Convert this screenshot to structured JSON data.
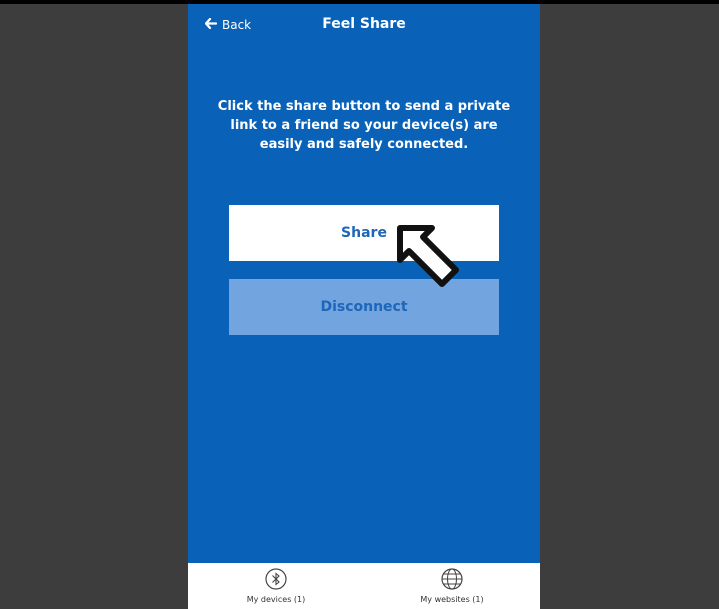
{
  "header": {
    "back_label": "Back",
    "title": "Feel Share"
  },
  "main": {
    "message": "Click the share button to send a private link to a friend so your device(s) are easily and safely connected.",
    "share_label": "Share",
    "disconnect_label": "Disconnect"
  },
  "tabbar": {
    "tabs": [
      {
        "label": "My devices (1)",
        "icon": "bluetooth-icon"
      },
      {
        "label": "My websites (1)",
        "icon": "globe-icon"
      }
    ]
  },
  "colors": {
    "app_blue": "#0a62b8",
    "disconnect_bg": "#72a5df",
    "frame_gray": "#3d3d3d"
  }
}
